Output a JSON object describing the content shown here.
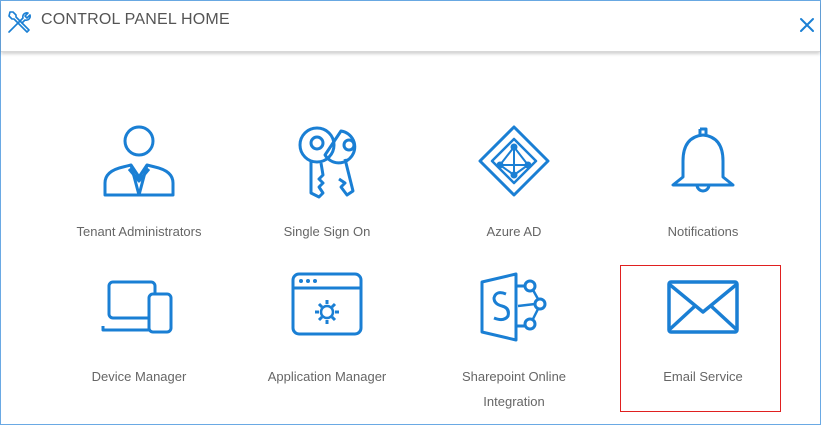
{
  "header": {
    "title": "CONTROL PANEL HOME",
    "icon": "tools-icon",
    "close_icon": "close-icon"
  },
  "colors": {
    "accent": "#1a7fd4",
    "highlight": "#e02020",
    "label": "#666666"
  },
  "tiles": [
    {
      "label": "Tenant Administrators",
      "icon": "user-admin-icon"
    },
    {
      "label": "Single Sign On",
      "icon": "keys-icon"
    },
    {
      "label": "Azure AD",
      "icon": "azure-ad-icon"
    },
    {
      "label": "Notifications",
      "icon": "bell-icon"
    },
    {
      "label": "Device Manager",
      "icon": "devices-icon"
    },
    {
      "label": "Application Manager",
      "icon": "application-window-icon"
    },
    {
      "label": "Sharepoint Online Integration",
      "icon": "sharepoint-icon"
    },
    {
      "label": "Email Service",
      "icon": "envelope-icon",
      "selected": true
    }
  ]
}
